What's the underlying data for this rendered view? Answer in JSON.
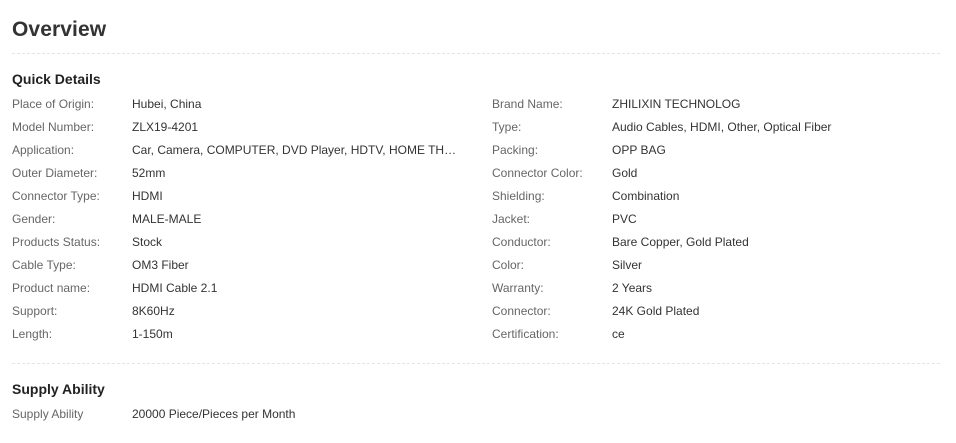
{
  "overview": {
    "title": "Overview"
  },
  "quick_details": {
    "title": "Quick Details",
    "rows": [
      {
        "label_left": "Place of Origin:",
        "value_left": "Hubei, China",
        "label_right": "Brand Name:",
        "value_right": "ZHILIXIN TECHNOLOG"
      },
      {
        "label_left": "Model Number:",
        "value_left": "ZLX19-4201",
        "label_right": "Type:",
        "value_right": "Audio Cables, HDMI, Other, Optical Fiber"
      },
      {
        "label_left": "Application:",
        "value_left": "Car, Camera, COMPUTER, DVD Player, HDTV, HOME THEATE...",
        "label_right": "Packing:",
        "value_right": "OPP BAG"
      },
      {
        "label_left": "Outer Diameter:",
        "value_left": "52mm",
        "label_right": "Connector Color:",
        "value_right": "Gold"
      },
      {
        "label_left": "Connector Type:",
        "value_left": "HDMI",
        "label_right": "Shielding:",
        "value_right": "Combination"
      },
      {
        "label_left": "Gender:",
        "value_left": "MALE-MALE",
        "label_right": "Jacket:",
        "value_right": "PVC"
      },
      {
        "label_left": "Products Status:",
        "value_left": "Stock",
        "label_right": "Conductor:",
        "value_right": "Bare Copper, Gold Plated"
      },
      {
        "label_left": "Cable Type:",
        "value_left": "OM3 Fiber",
        "label_right": "Color:",
        "value_right": "Silver"
      },
      {
        "label_left": "Product name:",
        "value_left": "HDMI Cable 2.1",
        "label_right": "Warranty:",
        "value_right": "2 Years"
      },
      {
        "label_left": "Support:",
        "value_left": "8K60Hz",
        "label_right": "Connector:",
        "value_right": "24K Gold Plated"
      },
      {
        "label_left": "Length:",
        "value_left": "1-150m",
        "label_right": "Certification:",
        "value_right": "ce"
      }
    ]
  },
  "supply_ability": {
    "title": "Supply Ability",
    "label": "Supply Ability",
    "value": "20000 Piece/Pieces per Month"
  }
}
